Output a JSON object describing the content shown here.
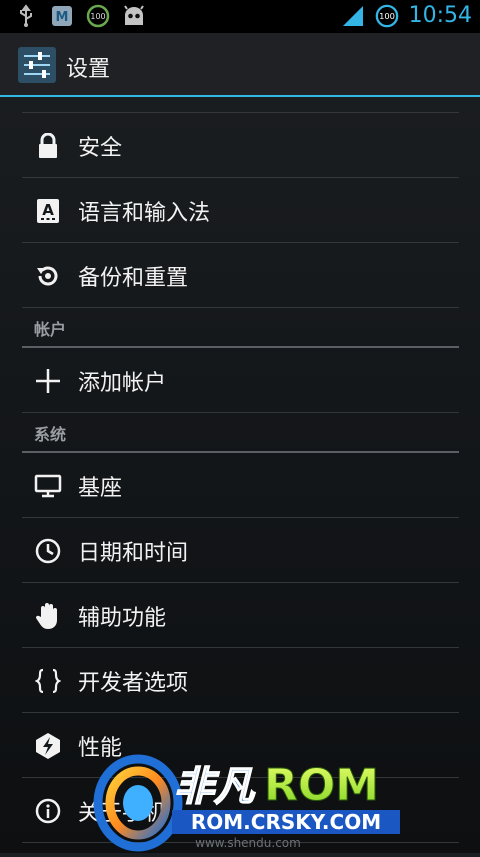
{
  "status_bar": {
    "time": "10:54",
    "battery_level": "100",
    "icons": [
      "usb-icon",
      "notification-app-icon",
      "battery-app-icon",
      "android-robot-icon",
      "signal-icon",
      "battery-icon"
    ]
  },
  "action_bar": {
    "title": "设置",
    "icon": "settings-sliders-icon"
  },
  "sections": {
    "personal_items": [
      {
        "label": "安全",
        "icon": "lock-icon"
      },
      {
        "label": "语言和输入法",
        "icon": "keyboard-a-icon"
      },
      {
        "label": "备份和重置",
        "icon": "backup-restore-icon"
      }
    ],
    "accounts_header": "帐户",
    "accounts_items": [
      {
        "label": "添加帐户",
        "icon": "plus-icon"
      }
    ],
    "system_header": "系统",
    "system_items": [
      {
        "label": "基座",
        "icon": "dock-monitor-icon"
      },
      {
        "label": "日期和时间",
        "icon": "clock-icon"
      },
      {
        "label": "辅助功能",
        "icon": "hand-icon"
      },
      {
        "label": "开发者选项",
        "icon": "braces-icon"
      },
      {
        "label": "性能",
        "icon": "performance-bolt-icon"
      },
      {
        "label": "关于手机",
        "icon": "info-icon"
      }
    ]
  },
  "watermark": {
    "brand": "非凡",
    "brand_rom": "ROM",
    "url": "ROM.CRSKY.COM",
    "sub": "www.shendu.com"
  },
  "colors": {
    "accent": "#33b5e5",
    "background": "#15181b",
    "divider": "#33373b"
  }
}
